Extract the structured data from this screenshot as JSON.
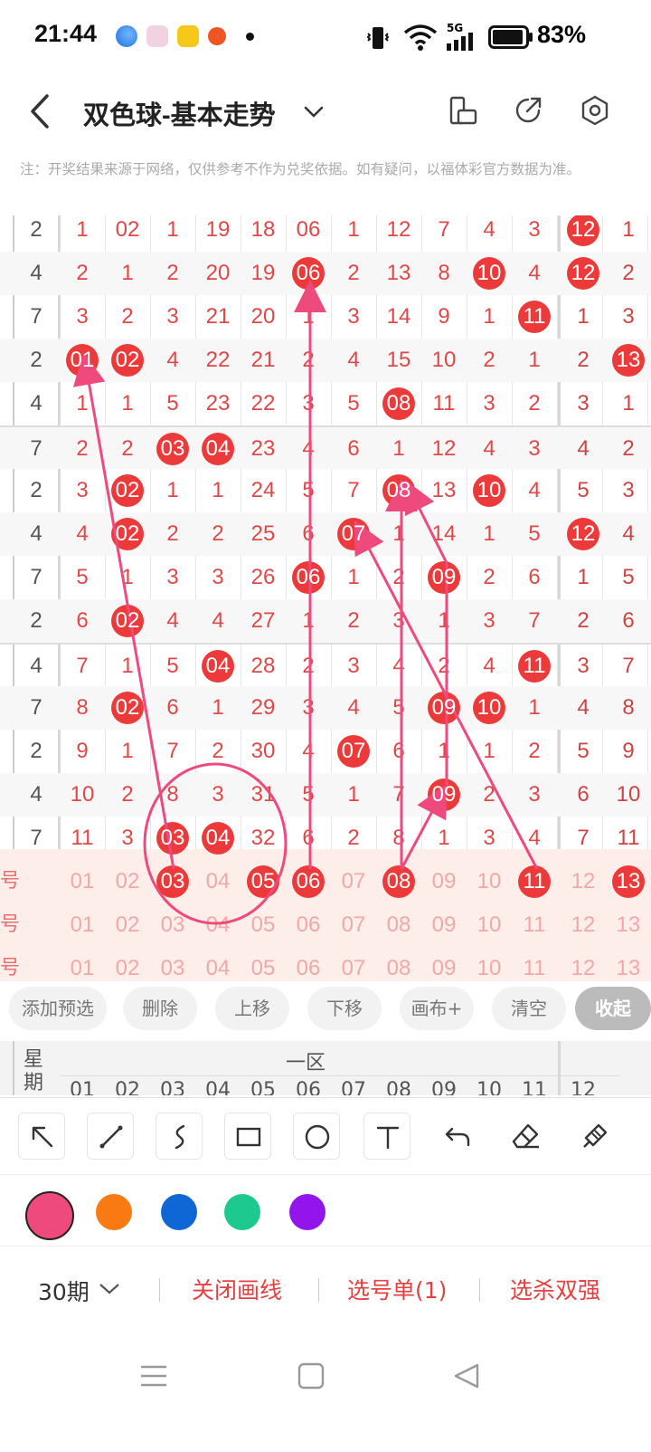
{
  "status": {
    "time": "21:44",
    "network": "5G",
    "battery": "83%"
  },
  "header": {
    "title": "双色球-基本走势"
  },
  "notice": "注：开奖结果来源于网络，仅供参考不作为兑奖依据。如有疑问，以福体彩官方数据为准。",
  "grid": {
    "rows": [
      {
        "w": "2",
        "c": [
          "1",
          "02",
          "1",
          "19",
          "18",
          "06",
          "1",
          "12",
          "7",
          "4",
          "3"
        ],
        "b": [
          "12",
          "1"
        ]
      },
      {
        "w": "4",
        "c": [
          "2",
          "1",
          "2",
          "20",
          "19",
          "06",
          "2",
          "13",
          "8",
          "10",
          "4"
        ],
        "b": [
          "12",
          "2"
        ]
      },
      {
        "w": "7",
        "c": [
          "3",
          "2",
          "3",
          "21",
          "20",
          "1",
          "3",
          "14",
          "9",
          "1",
          "11"
        ],
        "b": [
          "1",
          "3"
        ]
      },
      {
        "w": "2",
        "c": [
          "01",
          "02",
          "4",
          "22",
          "21",
          "2",
          "4",
          "15",
          "10",
          "2",
          "1"
        ],
        "b": [
          "2",
          "13"
        ]
      },
      {
        "w": "4",
        "c": [
          "1",
          "1",
          "5",
          "23",
          "22",
          "3",
          "5",
          "08",
          "11",
          "3",
          "2"
        ],
        "b": [
          "3",
          "1"
        ]
      },
      {
        "w": "7",
        "c": [
          "2",
          "2",
          "03",
          "04",
          "23",
          "4",
          "6",
          "1",
          "12",
          "4",
          "3"
        ],
        "b": [
          "4",
          "2"
        ]
      },
      {
        "w": "2",
        "c": [
          "3",
          "02",
          "1",
          "1",
          "24",
          "5",
          "7",
          "08",
          "13",
          "10",
          "4"
        ],
        "b": [
          "5",
          "3"
        ]
      },
      {
        "w": "4",
        "c": [
          "4",
          "02",
          "2",
          "2",
          "25",
          "6",
          "07",
          "1",
          "14",
          "1",
          "5"
        ],
        "b": [
          "12",
          "4"
        ]
      },
      {
        "w": "7",
        "c": [
          "5",
          "1",
          "3",
          "3",
          "26",
          "06",
          "1",
          "2",
          "09",
          "2",
          "6"
        ],
        "b": [
          "1",
          "5"
        ]
      },
      {
        "w": "2",
        "c": [
          "6",
          "02",
          "4",
          "4",
          "27",
          "1",
          "2",
          "3",
          "1",
          "3",
          "7"
        ],
        "b": [
          "2",
          "6"
        ]
      },
      {
        "w": "4",
        "c": [
          "7",
          "1",
          "5",
          "04",
          "28",
          "2",
          "3",
          "4",
          "2",
          "4",
          "11"
        ],
        "b": [
          "3",
          "7"
        ]
      },
      {
        "w": "7",
        "c": [
          "8",
          "02",
          "6",
          "1",
          "29",
          "3",
          "4",
          "5",
          "09",
          "10",
          "1"
        ],
        "b": [
          "4",
          "8"
        ]
      },
      {
        "w": "2",
        "c": [
          "9",
          "1",
          "7",
          "2",
          "30",
          "4",
          "07",
          "6",
          "1",
          "1",
          "2"
        ],
        "b": [
          "5",
          "9"
        ]
      },
      {
        "w": "4",
        "c": [
          "10",
          "2",
          "8",
          "3",
          "31",
          "5",
          "1",
          "7",
          "09",
          "2",
          "3"
        ],
        "b": [
          "6",
          "10"
        ]
      },
      {
        "w": "7",
        "c": [
          "11",
          "3",
          "03",
          "04",
          "32",
          "6",
          "2",
          "8",
          "1",
          "3",
          "4"
        ],
        "b": [
          "7",
          "11"
        ]
      }
    ],
    "balls": [
      [
        1,
        5
      ],
      [
        0,
        11
      ],
      [
        1,
        5
      ],
      [
        1,
        9
      ],
      [
        1,
        11
      ],
      [
        2,
        10
      ],
      [
        3,
        0
      ],
      [
        3,
        1
      ],
      [
        3,
        12
      ],
      [
        4,
        7
      ],
      [
        5,
        2
      ],
      [
        5,
        3
      ],
      [
        6,
        1
      ],
      [
        6,
        7
      ],
      [
        6,
        9
      ],
      [
        7,
        1
      ],
      [
        7,
        6
      ],
      [
        7,
        11
      ],
      [
        8,
        5
      ],
      [
        8,
        8
      ],
      [
        9,
        1
      ],
      [
        10,
        3
      ],
      [
        10,
        10
      ],
      [
        11,
        1
      ],
      [
        11,
        8
      ],
      [
        11,
        9
      ],
      [
        12,
        6
      ],
      [
        13,
        8
      ],
      [
        14,
        2
      ],
      [
        14,
        3
      ]
    ],
    "select_rows": [
      {
        "label": "号",
        "c": [
          "01",
          "02",
          "03",
          "04",
          "05",
          "06",
          "07",
          "08",
          "09",
          "10",
          "11",
          "12",
          "13"
        ]
      },
      {
        "label": "号",
        "c": [
          "01",
          "02",
          "03",
          "04",
          "05",
          "06",
          "07",
          "08",
          "09",
          "10",
          "11",
          "12",
          "13"
        ]
      },
      {
        "label": "号",
        "c": [
          "01",
          "02",
          "03",
          "04",
          "05",
          "06",
          "07",
          "08",
          "09",
          "10",
          "11",
          "12",
          "13"
        ]
      }
    ],
    "selected_balls": [
      "03",
      "05",
      "06",
      "08",
      "11",
      "13"
    ]
  },
  "chips": [
    "添加预选",
    "删除",
    "上移",
    "下移",
    "画布+",
    "清空",
    "收起"
  ],
  "subhead": {
    "week_label": "星期",
    "zone_label": "一区",
    "cols": [
      "01",
      "02",
      "03",
      "04",
      "05",
      "06",
      "07",
      "08",
      "09",
      "10",
      "11",
      "12"
    ]
  },
  "colors": [
    "#ef4a7e",
    "#f97a12",
    "#0f67d6",
    "#1ec98f",
    "#9216ec"
  ],
  "bottom": {
    "period": "30期",
    "close_draw": "关闭画线",
    "pick_list": "选号单(1)",
    "kill": "选杀双强"
  }
}
